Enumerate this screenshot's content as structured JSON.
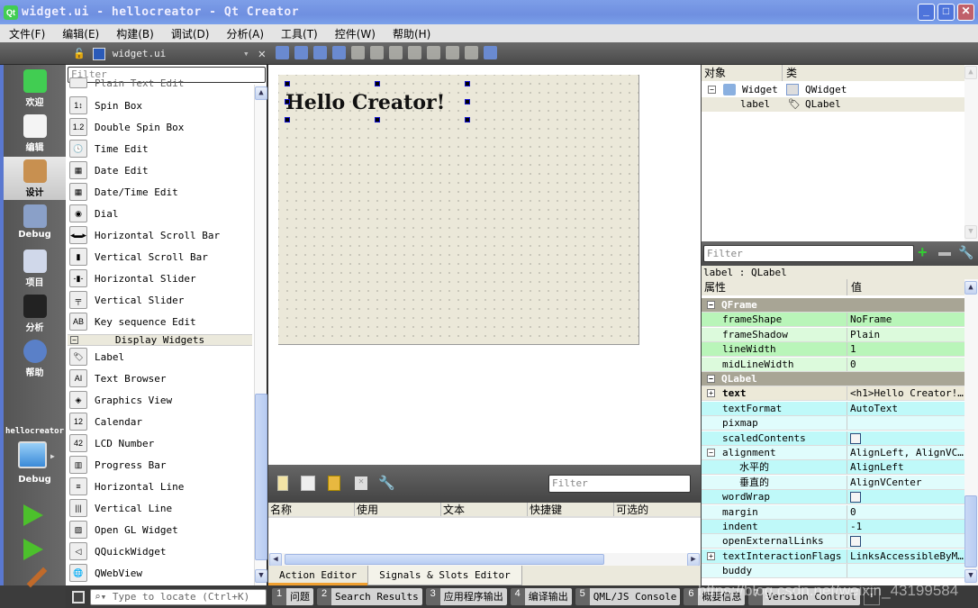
{
  "window": {
    "title": "widget.ui - hellocreator - Qt Creator",
    "app_icon": "qt-logo-icon",
    "minimize": "_",
    "maximize": "□",
    "close": "✕"
  },
  "menu": [
    "文件(F)",
    "编辑(E)",
    "构建(B)",
    "调试(D)",
    "分析(A)",
    "工具(T)",
    "控件(W)",
    "帮助(H)"
  ],
  "document": {
    "name": "widget.ui",
    "lock_icon": "unlocked-icon",
    "close": "✕"
  },
  "form_toolbar": [
    "edit-widgets-icon",
    "edit-signals-slots-icon",
    "edit-buddies-icon",
    "edit-tab-order-icon",
    "layout-horizontal-icon",
    "layout-vertical-icon",
    "layout-horizontal-splitter-icon",
    "layout-vertical-splitter-icon",
    "layout-form-icon",
    "layout-grid-icon",
    "break-layout-icon",
    "adjust-size-icon"
  ],
  "modes": [
    {
      "label": "欢迎",
      "icon": "qt-welcome-icon"
    },
    {
      "label": "编辑",
      "icon": "edit-document-icon"
    },
    {
      "label": "设计",
      "icon": "design-brush-icon",
      "active": true
    },
    {
      "label": "Debug",
      "icon": "debug-bug-icon"
    },
    {
      "label": "项目",
      "icon": "project-folder-icon"
    },
    {
      "label": "分析",
      "icon": "analyze-monitor-icon"
    },
    {
      "label": "帮助",
      "icon": "help-icon"
    }
  ],
  "kit": {
    "project": "hellocreator",
    "build": "Debug"
  },
  "widget_box": {
    "filter_placeholder": "Filter",
    "partial_top": "Plain Text Edit",
    "input_items": [
      {
        "label": "Spin Box",
        "icon": "1↕"
      },
      {
        "label": "Double Spin Box",
        "icon": "1.2"
      },
      {
        "label": "Time Edit",
        "icon": "🕓"
      },
      {
        "label": "Date Edit",
        "icon": "▦"
      },
      {
        "label": "Date/Time Edit",
        "icon": "▦"
      },
      {
        "label": "Dial",
        "icon": "◉"
      },
      {
        "label": "Horizontal Scroll Bar",
        "icon": "◂▬▸"
      },
      {
        "label": "Vertical Scroll Bar",
        "icon": "▮"
      },
      {
        "label": "Horizontal Slider",
        "icon": "-▮-"
      },
      {
        "label": "Vertical Slider",
        "icon": "╤"
      },
      {
        "label": "Key sequence Edit",
        "icon": "AB"
      }
    ],
    "display_category": "Display Widgets",
    "display_items": [
      {
        "label": "Label",
        "icon": "🏷"
      },
      {
        "label": "Text Browser",
        "icon": "AI"
      },
      {
        "label": "Graphics View",
        "icon": "◈"
      },
      {
        "label": "Calendar",
        "icon": "12"
      },
      {
        "label": "LCD Number",
        "icon": "42"
      },
      {
        "label": "Progress Bar",
        "icon": "▥"
      },
      {
        "label": "Horizontal Line",
        "icon": "≡"
      },
      {
        "label": "Vertical Line",
        "icon": "|||"
      },
      {
        "label": "Open GL Widget",
        "icon": "▨"
      },
      {
        "label": "QQuickWidget",
        "icon": "◁"
      },
      {
        "label": "QWebView",
        "icon": "🌐"
      }
    ]
  },
  "form": {
    "label_text": "Hello Creator!"
  },
  "action_editor": {
    "filter_placeholder": "Filter",
    "columns": [
      "名称",
      "使用",
      "文本",
      "快捷键",
      "可选的"
    ],
    "tabs": [
      "Action Editor",
      "Signals & Slots Editor"
    ]
  },
  "object_inspector": {
    "columns": [
      "对象",
      "类"
    ],
    "rows": [
      {
        "object": "Widget",
        "class": "QWidget"
      },
      {
        "object": "label",
        "class": "QLabel",
        "selected": true
      }
    ]
  },
  "property_editor": {
    "filter_placeholder": "Filter",
    "object": "label : QLabel",
    "columns": [
      "属性",
      "值"
    ],
    "rows": [
      {
        "type": "cat",
        "name": "QFrame"
      },
      {
        "name": "frameShape",
        "value": "NoFrame",
        "color": "#b9f5b9"
      },
      {
        "name": "frameShadow",
        "value": "Plain",
        "color": "#dcfadc"
      },
      {
        "name": "lineWidth",
        "value": "1",
        "color": "#b9f5b9"
      },
      {
        "name": "midLineWidth",
        "value": "0",
        "color": "#dcfadc"
      },
      {
        "type": "cat",
        "name": "QLabel"
      },
      {
        "name": "text",
        "value": "<h1>Hello Creator!…",
        "color": "#ece9d8",
        "bold": true,
        "expand": "+"
      },
      {
        "name": "textFormat",
        "value": "AutoText",
        "color": "#bff9f9"
      },
      {
        "name": "pixmap",
        "value": "",
        "color": "#e0fcfc"
      },
      {
        "name": "scaledContents",
        "value": "",
        "checkbox": true,
        "color": "#bff9f9"
      },
      {
        "name": "alignment",
        "value": "AlignLeft, AlignVC…",
        "color": "#e0fcfc",
        "expand": "−"
      },
      {
        "name": "水平的",
        "value": "AlignLeft",
        "color": "#bff9f9",
        "sub": true
      },
      {
        "name": "垂直的",
        "value": "AlignVCenter",
        "color": "#e0fcfc",
        "sub": true
      },
      {
        "name": "wordWrap",
        "value": "",
        "checkbox": true,
        "color": "#bff9f9"
      },
      {
        "name": "margin",
        "value": "0",
        "color": "#e0fcfc"
      },
      {
        "name": "indent",
        "value": "-1",
        "color": "#bff9f9"
      },
      {
        "name": "openExternalLinks",
        "value": "",
        "checkbox": true,
        "color": "#e0fcfc"
      },
      {
        "name": "textInteractionFlags",
        "value": "LinksAccessibleByM…",
        "color": "#bff9f9",
        "expand": "+"
      },
      {
        "name": "buddy",
        "value": "",
        "color": "#e0fcfc"
      }
    ]
  },
  "statusbar": {
    "locate_placeholder": "⌕▾ Type to locate (Ctrl+K)",
    "tabs": [
      {
        "n": "1",
        "label": "问题"
      },
      {
        "n": "2",
        "label": "Search Results"
      },
      {
        "n": "3",
        "label": "应用程序输出"
      },
      {
        "n": "4",
        "label": "编译输出"
      },
      {
        "n": "5",
        "label": "QML/JS Console"
      },
      {
        "n": "6",
        "label": "概要信息"
      },
      {
        "n": "7",
        "label": "Version Control"
      }
    ]
  },
  "watermark": "https://blog.csdn.net/weixin_43199584"
}
